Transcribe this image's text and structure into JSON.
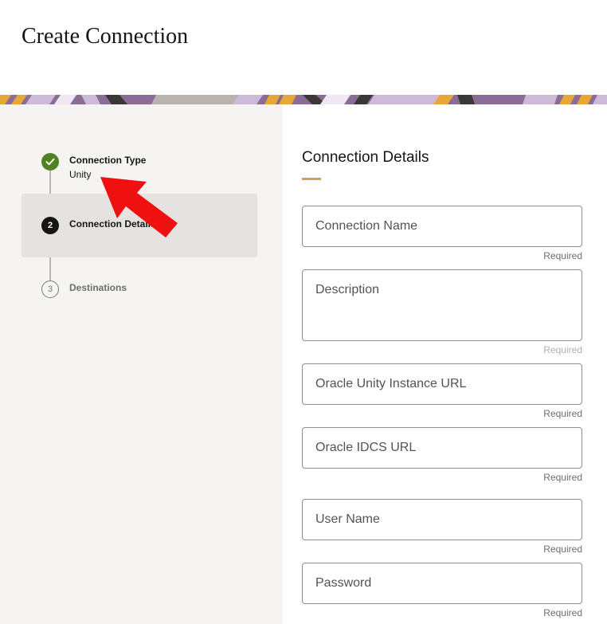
{
  "page": {
    "title": "Create Connection"
  },
  "banner": {
    "colors": [
      "#e8a636",
      "#8a6c96",
      "#cdb9d8",
      "#3a3836",
      "#b8b4ad",
      "#efe7f3"
    ]
  },
  "steps": [
    {
      "number": "",
      "title": "Connection Type",
      "subtitle": "Unity",
      "state": "completed",
      "icon": "check-icon"
    },
    {
      "number": "2",
      "title": "Connection Details",
      "state": "current"
    },
    {
      "number": "3",
      "title": "Destinations",
      "state": "upcoming"
    }
  ],
  "annotation": {
    "arrow_color": "#f01010"
  },
  "section": {
    "title": "Connection Details"
  },
  "fields": [
    {
      "placeholder": "Connection Name",
      "helper": "Required"
    },
    {
      "placeholder": "Description",
      "helper": "Required"
    },
    {
      "placeholder": "Oracle Unity Instance URL",
      "helper": "Required"
    },
    {
      "placeholder": "Oracle IDCS URL",
      "helper": "Required"
    },
    {
      "placeholder": "User Name",
      "helper": "Required"
    },
    {
      "placeholder": "Password",
      "helper": "Required"
    }
  ],
  "colors": {
    "accent": "#c9a265",
    "success": "#508223",
    "sidebar_bg": "#f5f4f2"
  }
}
